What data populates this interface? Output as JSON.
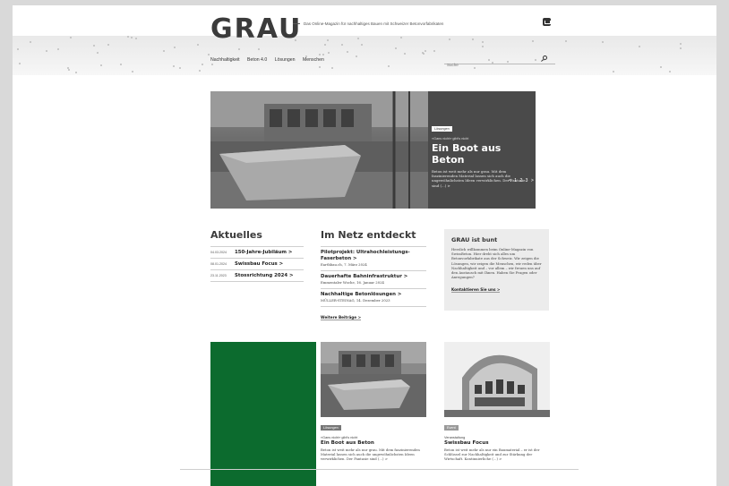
{
  "header": {
    "logo": "GRAU",
    "tagline": "Das Online-Magazin für nachhaltiges Bauen mit Schweizer Betonvorfabrikaten"
  },
  "nav": {
    "items": [
      "Nachhaltigkeit",
      "Beton 4.0",
      "Lösungen",
      "Menschen"
    ]
  },
  "search": {
    "placeholder": "Suche"
  },
  "hero": {
    "pager": "< 1 2 3 >",
    "tag": "Lösungen",
    "kicker": "«Gans nicht» gibt's nicht",
    "title": "Ein Boot aus Beton",
    "text": "Beton ist weit mehr als nur grau. Mit dem faszinierenden Material lassen sich auch die ungewöhnlichsten Ideen verwirklichen. Der Fantasie sind (...)",
    "more": ">"
  },
  "aktuelles": {
    "heading": "Aktuelles",
    "items": [
      {
        "date": "04.03.2024",
        "title": "150-Jahre-Jubiläum >"
      },
      {
        "date": "08.01.2024",
        "title": "Swissbau Focus >"
      },
      {
        "date": "23.11.2023",
        "title": "Stossrichtung 2024 >"
      }
    ]
  },
  "netz": {
    "heading": "Im Netz entdeckt",
    "items": [
      {
        "title": "Pilotprojekt: Ultrahochleistungs-Faserbeton >",
        "source": "Earthbau.ch, 7. März 2024"
      },
      {
        "title": "Dauerhafte Bahninfrastruktur >",
        "source": "Emmentaler Woche, 16. Januar 2024"
      },
      {
        "title": "Nachhaltige Betonlösungen >",
        "source": "MÜLLER-STEINAG, 14. Dezember 2023"
      }
    ],
    "more": "Weitere Beiträge >"
  },
  "infobox": {
    "title": "GRAU ist bunt",
    "text": "Herzlich willkommen beim Online-Magazin von SwissBeton. Hier dreht sich alles um Betonvorfabrikate aus der Schweiz. Wir zeigen die Lösungen, wir zeigen die Menschen, wir reden über Nachhaltigkeit und – vor allem – wir freuen uns auf den Austausch mit Ihnen. Haben Sie Fragen oder Anregungen?",
    "link": "Kontaktieren Sie uns >"
  },
  "cards": [
    {
      "tag": "Lösungen",
      "kicker": "«Gans nicht» gibt's nicht",
      "title": "Ein Boot aus Beton",
      "text": "Beton ist weit mehr als nur grau. Mit dem faszinierenden Material lassen sich auch die ungewöhnlichsten Ideen verwirklichen. Der Fantasie sind (...) >"
    },
    {
      "tag": "Event",
      "kicker": "Veranstaltung",
      "title": "Swissbau Focus",
      "text": "Beton ist weit mehr als nur ein Baumaterial – er ist der Schlüssel zur Nachhaltigkeit und zur Stärkung der Wirtschaft. Kontinuierliche (...) >"
    }
  ],
  "colors": {
    "ad_green": "#0c6b2e",
    "hero_bg": "#4a4a4a",
    "box_bg": "#ececec"
  }
}
